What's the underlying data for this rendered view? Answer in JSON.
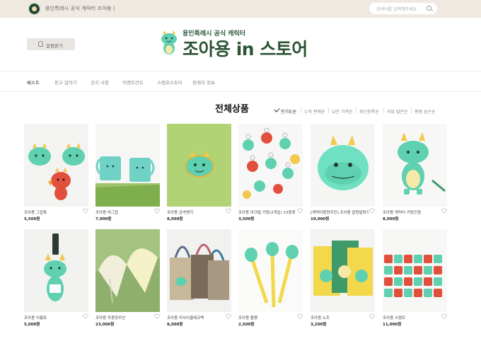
{
  "topbar": {
    "site_text": "용인특례시 공식 캐릭터 조아용  |",
    "search_placeholder": "검색어를 입력해주세요"
  },
  "header": {
    "alarm_label": "알림받기",
    "brand_sub": "용인특례시 공식 캐릭터",
    "brand_main": "조아용 in 스토어"
  },
  "nav": {
    "items": [
      "베스트",
      "등고 알아기",
      "공지 사항",
      "이벤트안트",
      "스탬프스토어",
      "판매자 정보"
    ]
  },
  "section": {
    "title": "전체상품",
    "sort_options": [
      "인기도순",
      "누적 판매순",
      "낮은 가격순",
      "최신등록순",
      "리뷰 많은순",
      "평점 높은순"
    ]
  },
  "products": [
    {
      "name": "조아용 그립톡",
      "price": "5,500원"
    },
    {
      "name": "조아용 머그컵",
      "price": "7,000원"
    },
    {
      "name": "조아용 금속뱃지",
      "price": "8,000원"
    },
    {
      "name": "조아용 아크릴 키링(2개입) 13종류",
      "price": "3,500원"
    },
    {
      "name": "[캐릭터용양주민] 조아용 말랑말랑쿠션",
      "price": "19,000원"
    },
    {
      "name": "조아용 캐릭터 키링인형",
      "price": "8,000원"
    },
    {
      "name": "조아용 이름표",
      "price": "5,000원"
    },
    {
      "name": "조아용 자동양우산",
      "price": "23,000원"
    },
    {
      "name": "조아용 리사이클에코백",
      "price": "8,000원"
    },
    {
      "name": "조아용 볼펜",
      "price": "2,500원"
    },
    {
      "name": "조아용 노트",
      "price": "3,200원"
    },
    {
      "name": "조아용 스탬프",
      "price": "11,000원"
    }
  ],
  "colors": {
    "topbar_bg": "#efe9e2",
    "brand_green": "#2b5535",
    "mascot_mint": "#5fd0b0"
  }
}
